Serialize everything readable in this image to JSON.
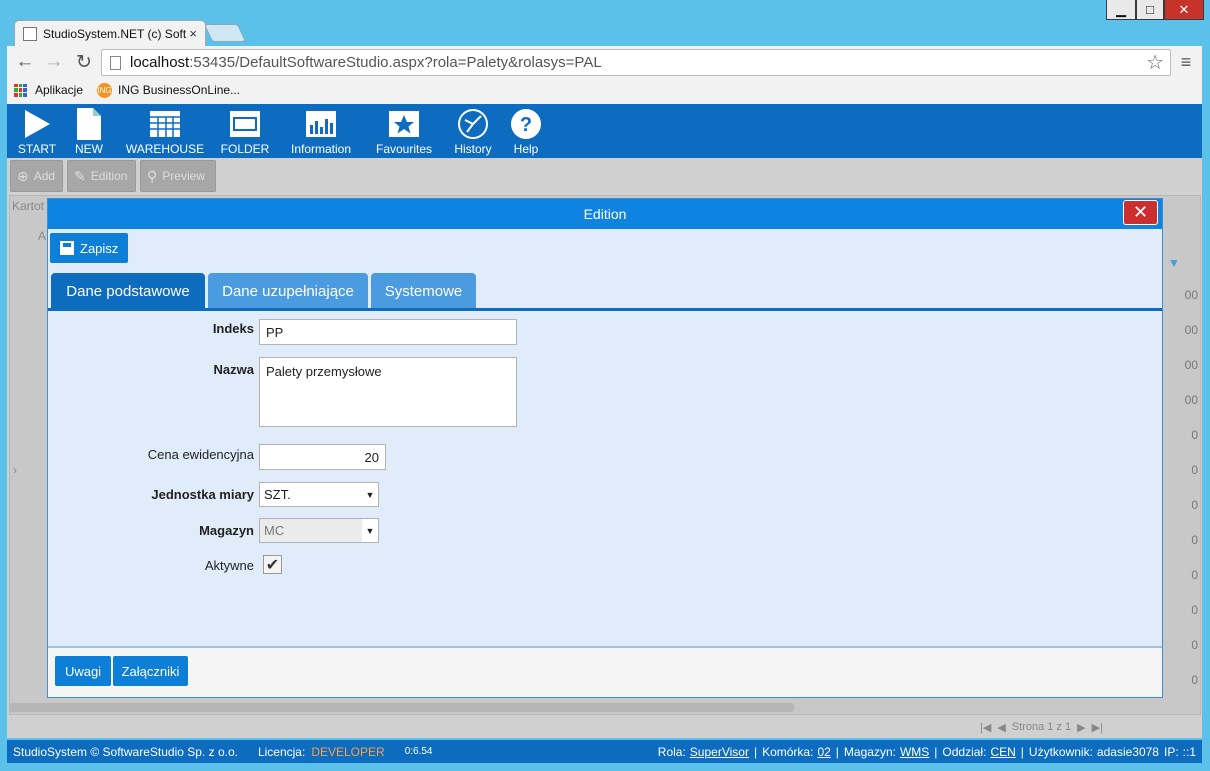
{
  "browser": {
    "tab_title": "StudioSystem.NET (c) Soft",
    "tab_close": "×",
    "url_host": "localhost",
    "url_rest": ":53435/DefaultSoftwareStudio.aspx?rola=Palety&rolasys=PAL",
    "bookmarks": [
      "Aplikacje",
      "ING BusinessOnLine..."
    ],
    "window_controls": [
      "▁",
      "□",
      "✕"
    ]
  },
  "app_toolbar": [
    {
      "label": "START",
      "icon": "play-icon"
    },
    {
      "label": "NEW",
      "icon": "document-icon"
    },
    {
      "label": "WAREHOUSE",
      "icon": "grid-icon"
    },
    {
      "label": "FOLDER",
      "icon": "window-icon"
    },
    {
      "label": "Information",
      "icon": "bar-chart-icon"
    },
    {
      "label": "Favourites",
      "icon": "star-icon"
    },
    {
      "label": "History",
      "icon": "history-icon"
    },
    {
      "label": "Help",
      "icon": "help-icon"
    }
  ],
  "secondary_toolbar": {
    "add": "Add",
    "edition": "Edition",
    "preview": "Preview"
  },
  "background": {
    "breadcrumb": "Kartot",
    "col_letter": "A",
    "row_values": [
      "00",
      "00",
      "00",
      "00",
      "0",
      "0",
      "0",
      "0",
      "0",
      "0",
      "0",
      "0"
    ],
    "pager": "Strona 1 z 1"
  },
  "modal": {
    "title": "Edition",
    "save_label": "Zapisz",
    "tabs": [
      "Dane podstawowe",
      "Dane uzupełniające",
      "Systemowe"
    ],
    "fields": {
      "indeks_label": "Indeks",
      "indeks_value": "PP",
      "nazwa_label": "Nazwa",
      "nazwa_value": "Palety przemysłowe",
      "cena_label": "Cena ewidencyjna",
      "cena_value": "20",
      "jednostka_label": "Jednostka miary",
      "jednostka_value": "SZT.",
      "magazyn_label": "Magazyn",
      "magazyn_value": "MC",
      "aktywne_label": "Aktywne",
      "aktywne_checked": true
    },
    "footer_buttons": [
      "Uwagi",
      "Załączniki"
    ]
  },
  "status": {
    "copyright": "StudioSystem © SoftwareStudio Sp. z o.o.",
    "licence_label": "Licencja:",
    "licence_value": "DEVELOPER",
    "time": "0:6.54",
    "rola_label": "Rola:",
    "rola_value": "SuperVisor",
    "komorka_label": "Komórka:",
    "komorka_value": "02",
    "magazyn_label": "Magazyn:",
    "magazyn_value": "WMS",
    "oddzial_label": "Oddział:",
    "oddzial_value": "CEN",
    "uzytkownik_label": "Użytkownik:",
    "uzytkownik_value": "adasie3078",
    "ip_label": "IP:",
    "ip_value": "::1"
  }
}
